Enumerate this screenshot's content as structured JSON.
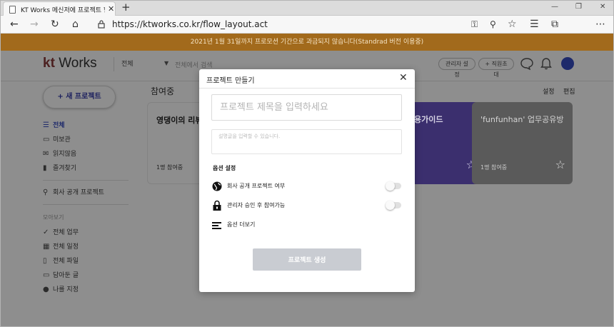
{
  "browser": {
    "tab_title": "KT Works 메신저에 프로젝트 협업",
    "url": "https://ktworks.co.kr/flow_layout.act"
  },
  "banner": {
    "text": "2021년 1월 31일까지 프로모션 기간으로 과금되지 않습니다(Standrad 버전 이용중)"
  },
  "header": {
    "logo_kt": "kt",
    "logo_works": "Works",
    "scope": "전체",
    "search_placeholder": "전체에서 검색",
    "admin_settings": "관리자 설정",
    "invite": "+ 직원초대"
  },
  "sidebar": {
    "new_project": "+ 새 프로젝트",
    "items": [
      {
        "label": "전체",
        "icon": "list-icon"
      },
      {
        "label": "미보관",
        "icon": "archive-icon"
      },
      {
        "label": "읽지않음",
        "icon": "mail-icon"
      },
      {
        "label": "즐겨찾기",
        "icon": "bookmark-icon"
      }
    ],
    "public_projects": "회사 공개 프로젝트",
    "section_head": "모아보기",
    "collections": [
      {
        "label": "전체 업무",
        "icon": "check-icon"
      },
      {
        "label": "전체 일정",
        "icon": "calendar-icon"
      },
      {
        "label": "전체 파일",
        "icon": "file-icon"
      },
      {
        "label": "담아둔 글",
        "icon": "folder-icon"
      },
      {
        "label": "나를 지정",
        "icon": "user-icon"
      }
    ]
  },
  "main": {
    "title": "참여중",
    "settings": "설정",
    "edit": "편집",
    "cards": [
      {
        "title": "영댕이의 리뷰",
        "foot": "1명 참여중",
        "color": "#8e8e8e"
      },
      {
        "title": "용가이드",
        "foot": "",
        "color": "#3b2f6e"
      },
      {
        "title": "'funfunhan' 업무공유방",
        "foot": "1명 참여중",
        "color": "#5a5a5a"
      }
    ]
  },
  "modal": {
    "title": "프로젝트 만들기",
    "title_placeholder": "프로젝트 제목을 입력하세요",
    "desc_placeholder": "설명글을 입력할 수 있습니다.",
    "options_head": "옵션 설정",
    "options": [
      {
        "label": "회사 공개 프로젝트 여부",
        "icon": "globe-icon"
      },
      {
        "label": "관리자 승인 후 참여가능",
        "icon": "lock-icon"
      },
      {
        "label": "옵션 더보기",
        "icon": "menu-lines-icon"
      }
    ],
    "submit": "프로젝트 생성"
  }
}
